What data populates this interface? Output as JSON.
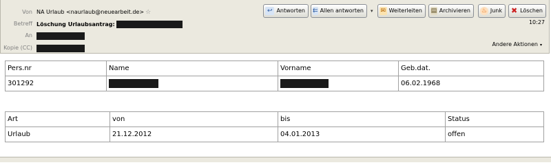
{
  "header": {
    "from_label": "Von",
    "from_value": "NA Urlaub <naurlaub@neuearbeit.de>",
    "subject_label": "Betreff",
    "subject_value": "Löschung Urlaubsantrag:",
    "to_label": "An",
    "cc_label": "Kopie (CC)",
    "time": "10:27",
    "more_actions": "Andere Aktionen"
  },
  "toolbar": {
    "reply": "Antworten",
    "reply_all": "Allen antworten",
    "forward": "Weiterleiten",
    "archive": "Archivieren",
    "junk": "Junk",
    "delete": "Löschen"
  },
  "table1": {
    "headers": [
      "Pers.nr",
      "Name",
      "Vorname",
      "Geb.dat."
    ],
    "row": [
      "301292",
      "",
      "",
      "06.02.1968"
    ]
  },
  "table2": {
    "headers": [
      "Art",
      "von",
      "bis",
      "Status"
    ],
    "row": [
      "Urlaub",
      "21.12.2012",
      "04.01.2013",
      "offen"
    ]
  },
  "colors": {
    "header_bg": "#ebe9df",
    "redaction": "#1a1a1a",
    "delete_icon": "#cc2020",
    "junk_icon": "#e87010"
  },
  "icons": [
    "star-icon",
    "reply-icon",
    "reply-all-icon",
    "forward-icon",
    "archive-icon",
    "junk-icon",
    "delete-icon",
    "dropdown-caret-icon"
  ]
}
